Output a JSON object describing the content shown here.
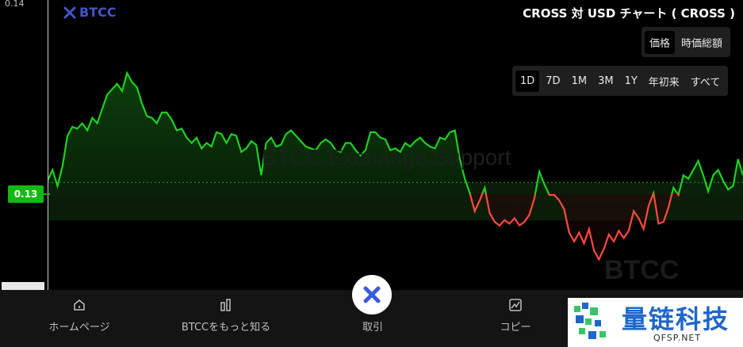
{
  "brand": {
    "logo_text": "BTCC"
  },
  "title": "CROSS 対 USD チャート ( CROSS )",
  "metric_toggle": [
    {
      "label": "価格",
      "active": true
    },
    {
      "label": "時価総額",
      "active": false
    }
  ],
  "range_toggle": [
    {
      "label": "1D",
      "active": true
    },
    {
      "label": "7D",
      "active": false
    },
    {
      "label": "1M",
      "active": false
    },
    {
      "label": "3M",
      "active": false
    },
    {
      "label": "1Y",
      "active": false
    },
    {
      "label": "年初来",
      "active": false
    },
    {
      "label": "すべて",
      "active": false
    }
  ],
  "y_axis": {
    "top_tick": "0.14",
    "current_price": "0.13"
  },
  "watermarks": {
    "center": "BTCC Exchange Support",
    "bottom_right": "BTCC"
  },
  "chart_data": {
    "type": "line",
    "ylim": [
      0.124,
      0.14
    ],
    "baseline": 0.13,
    "colors": {
      "above": "#1fd01f",
      "below": "#ff4a3d"
    },
    "y": [
      0.1301,
      0.1307,
      0.1298,
      0.1309,
      0.1326,
      0.1331,
      0.133,
      0.1333,
      0.1329,
      0.1336,
      0.1333,
      0.1341,
      0.1349,
      0.1352,
      0.1355,
      0.1351,
      0.1361,
      0.1356,
      0.1353,
      0.1344,
      0.1337,
      0.1336,
      0.1333,
      0.1339,
      0.1339,
      0.1335,
      0.1329,
      0.133,
      0.1325,
      0.1322,
      0.1325,
      0.1319,
      0.1322,
      0.132,
      0.1328,
      0.1327,
      0.1322,
      0.1327,
      0.1326,
      0.1317,
      0.1319,
      0.1323,
      0.1321,
      0.1304,
      0.1322,
      0.1325,
      0.132,
      0.1321,
      0.1327,
      0.1329,
      0.1326,
      0.1323,
      0.132,
      0.1319,
      0.1318,
      0.1322,
      0.1324,
      0.1322,
      0.1318,
      0.1317,
      0.1322,
      0.1322,
      0.1318,
      0.1315,
      0.1318,
      0.1328,
      0.1328,
      0.1325,
      0.1324,
      0.1318,
      0.1319,
      0.1317,
      0.1322,
      0.132,
      0.1323,
      0.1325,
      0.1322,
      0.132,
      0.1319,
      0.1325,
      0.1324,
      0.1328,
      0.1329,
      0.1313,
      0.1302,
      0.1294,
      0.1284,
      0.129,
      0.1297,
      0.1283,
      0.1278,
      0.1276,
      0.1279,
      0.1277,
      0.128,
      0.1276,
      0.1278,
      0.1282,
      0.1291,
      0.1306,
      0.1299,
      0.1293,
      0.1293,
      0.129,
      0.1285,
      0.1272,
      0.1267,
      0.1272,
      0.1266,
      0.1274,
      0.1262,
      0.1257,
      0.1263,
      0.1271,
      0.1267,
      0.1273,
      0.1269,
      0.1273,
      0.1284,
      0.128,
      0.1274,
      0.1287,
      0.1294,
      0.1277,
      0.1278,
      0.1286,
      0.1297,
      0.1293,
      0.1304,
      0.1302,
      0.1307,
      0.1312,
      0.1304,
      0.1295,
      0.1304,
      0.1307,
      0.1301,
      0.1296,
      0.1298,
      0.1313,
      0.1304
    ]
  },
  "bottom_nav": [
    {
      "label": "ホームページ",
      "icon": "home-icon"
    },
    {
      "label": "BTCCをもっと知る",
      "icon": "info-bars-icon"
    },
    {
      "label": "取引",
      "icon": "trade-x-icon"
    },
    {
      "label": "コピー",
      "icon": "copy-chart-icon"
    }
  ],
  "badge": {
    "name": "量链科技",
    "sub": "QFSP.NET"
  }
}
